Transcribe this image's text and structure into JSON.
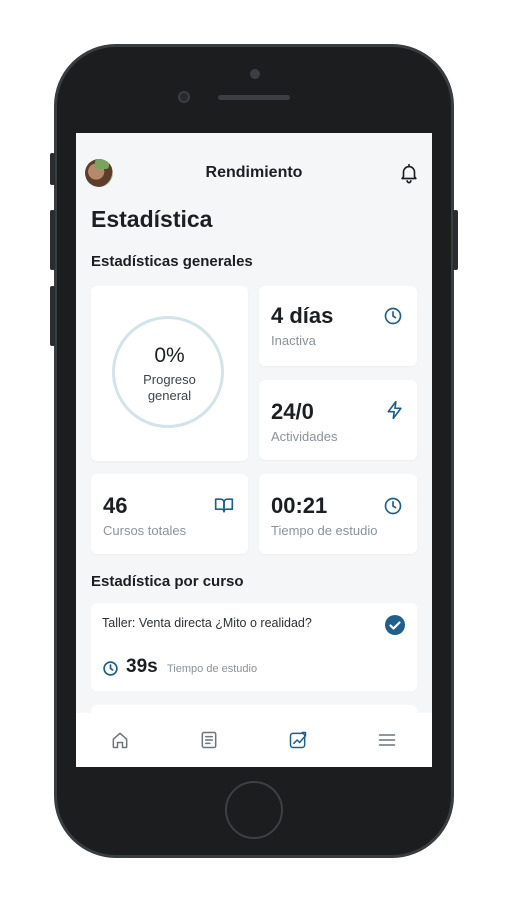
{
  "header": {
    "title": "Rendimiento"
  },
  "page": {
    "title": "Estadística"
  },
  "general": {
    "heading": "Estadísticas generales",
    "progress": {
      "value": "0%",
      "label": "Progreso general",
      "fraction": 0
    },
    "inactive": {
      "value": "4 días",
      "label": "Inactiva"
    },
    "activities": {
      "value": "24/0",
      "label": "Actividades"
    },
    "courses": {
      "value": "46",
      "label": "Cursos totales"
    },
    "study_time": {
      "value": "00:21",
      "label": "Tiempo de estudio"
    }
  },
  "per_course": {
    "heading": "Estadística por curso",
    "items": [
      {
        "title": "Taller: Venta directa ¿Mito o realidad?",
        "time": "39s",
        "time_label": "Tiempo de estudio",
        "completed": true
      }
    ]
  },
  "nav": {
    "items": [
      {
        "icon": "home-icon",
        "active": false
      },
      {
        "icon": "courses-icon",
        "active": false
      },
      {
        "icon": "stats-icon",
        "active": true
      },
      {
        "icon": "menu-icon",
        "active": false
      }
    ]
  },
  "colors": {
    "accent": "#1f5f8b",
    "ring": "#d3e3ea",
    "background": "#f4f6f8"
  }
}
